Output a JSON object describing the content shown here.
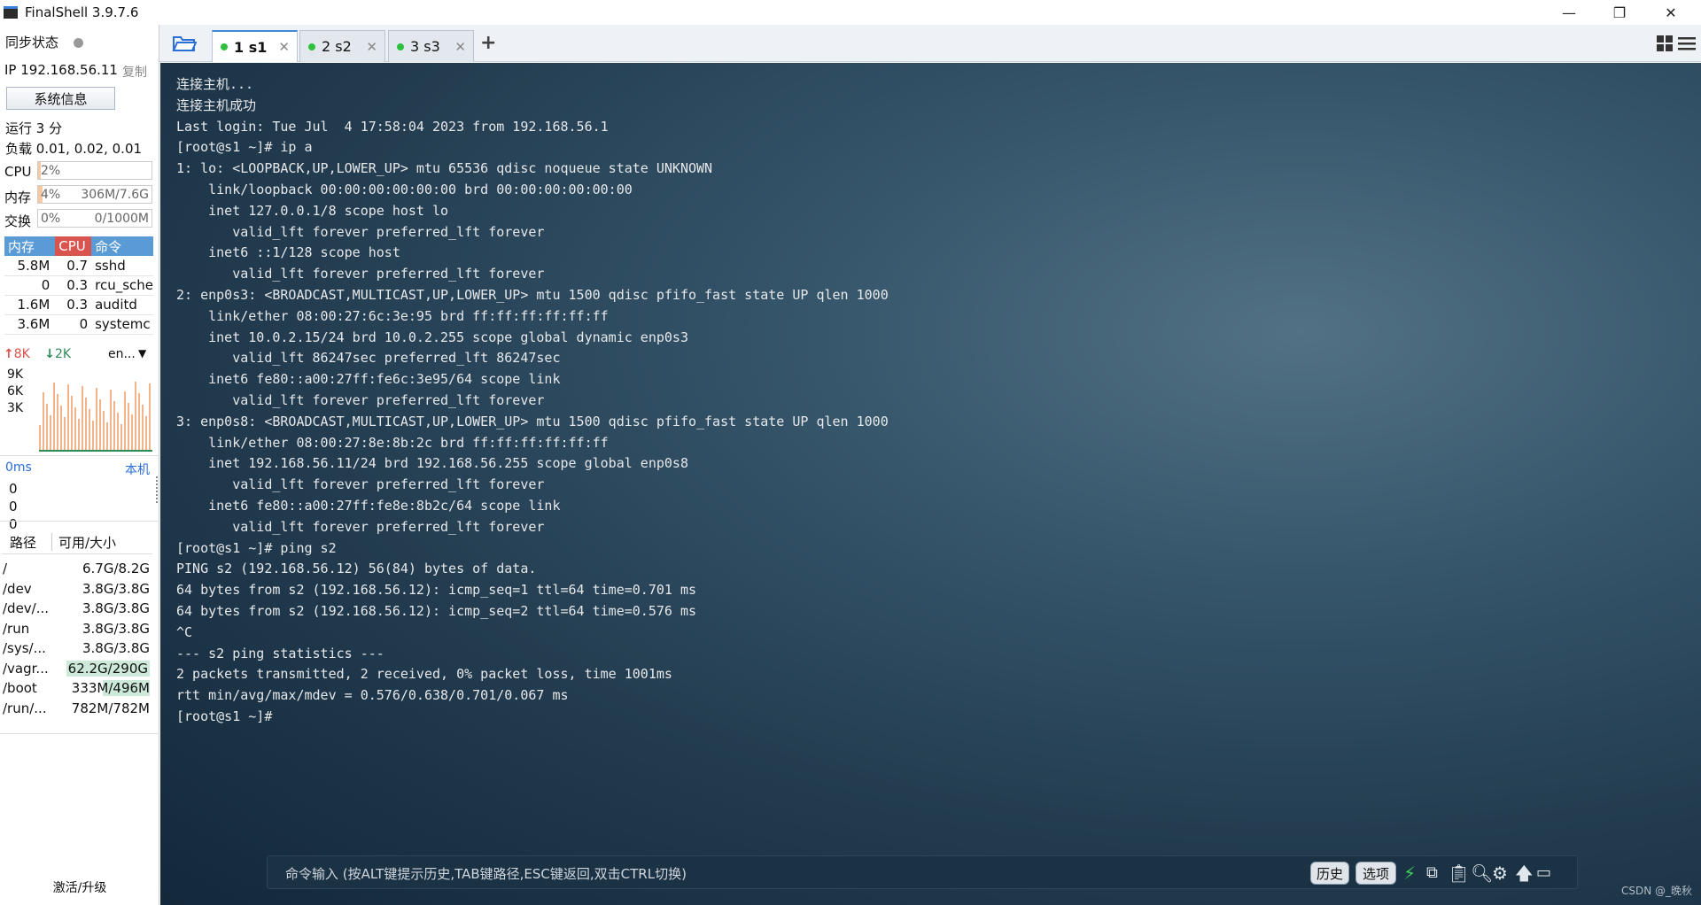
{
  "window": {
    "title": "FinalShell 3.9.7.6",
    "minimize": "—",
    "maximize": "❐",
    "close": "✕"
  },
  "sidebar": {
    "sync_label": "同步状态",
    "ip": "IP 192.168.56.11",
    "copy": "复制",
    "sysinfo_button": "系统信息",
    "uptime": "运行 3 分",
    "load": "负载 0.01, 0.02, 0.01",
    "cpu": {
      "label": "CPU",
      "value": "2%",
      "fraction": 0.02
    },
    "mem": {
      "label": "内存",
      "percent": "4%",
      "value": "306M/7.6G",
      "fraction": 0.04
    },
    "swap": {
      "label": "交换",
      "percent": "0%",
      "value": "0/1000M",
      "fraction": 0.0
    },
    "proc_headers": [
      "内存",
      "CPU",
      "命令"
    ],
    "processes": [
      {
        "mem": "5.8M",
        "cpu": "0.7",
        "cmd": "sshd"
      },
      {
        "mem": "0",
        "cpu": "0.3",
        "cmd": "rcu_sche"
      },
      {
        "mem": "1.6M",
        "cpu": "0.3",
        "cmd": "auditd"
      },
      {
        "mem": "3.6M",
        "cpu": "0",
        "cmd": "systemc"
      }
    ],
    "net": {
      "up": "8K",
      "down": "2K",
      "iface": "en...",
      "ticks": [
        "9K",
        "6K",
        "3K"
      ]
    },
    "ping": {
      "latency": "0ms",
      "host": "本机",
      "values": [
        "0",
        "0",
        "0"
      ]
    },
    "disk_headers": [
      "路径",
      "可用/大小"
    ],
    "disks": [
      {
        "path": "/",
        "size": "6.7G/8.2G"
      },
      {
        "path": "/dev",
        "size": "3.8G/3.8G"
      },
      {
        "path": "/dev/...",
        "size": "3.8G/3.8G"
      },
      {
        "path": "/run",
        "size": "3.8G/3.8G"
      },
      {
        "path": "/sys/...",
        "size": "3.8G/3.8G"
      },
      {
        "path": "/vagr...",
        "size": "62.2G/290G"
      },
      {
        "path": "/boot",
        "size": "333M/496M"
      },
      {
        "path": "/run/...",
        "size": "782M/782M"
      }
    ],
    "activate": "激活/升级"
  },
  "tabs": [
    {
      "label": "1 s1",
      "close": "✕"
    },
    {
      "label": "2 s2",
      "close": "✕"
    },
    {
      "label": "3 s3",
      "close": "✕"
    }
  ],
  "add_tab": "+",
  "terminal": {
    "lines": [
      "连接主机...",
      "连接主机成功",
      "Last login: Tue Jul  4 17:58:04 2023 from 192.168.56.1",
      "[root@s1 ~]# ip a",
      "1: lo: <LOOPBACK,UP,LOWER_UP> mtu 65536 qdisc noqueue state UNKNOWN",
      "    link/loopback 00:00:00:00:00:00 brd 00:00:00:00:00:00",
      "    inet 127.0.0.1/8 scope host lo",
      "       valid_lft forever preferred_lft forever",
      "    inet6 ::1/128 scope host",
      "       valid_lft forever preferred_lft forever",
      "2: enp0s3: <BROADCAST,MULTICAST,UP,LOWER_UP> mtu 1500 qdisc pfifo_fast state UP qlen 1000",
      "    link/ether 08:00:27:6c:3e:95 brd ff:ff:ff:ff:ff:ff",
      "    inet 10.0.2.15/24 brd 10.0.2.255 scope global dynamic enp0s3",
      "       valid_lft 86247sec preferred_lft 86247sec",
      "    inet6 fe80::a00:27ff:fe6c:3e95/64 scope link",
      "       valid_lft forever preferred_lft forever",
      "3: enp0s8: <BROADCAST,MULTICAST,UP,LOWER_UP> mtu 1500 qdisc pfifo_fast state UP qlen 1000",
      "    link/ether 08:00:27:8e:8b:2c brd ff:ff:ff:ff:ff:ff",
      "    inet 192.168.56.11/24 brd 192.168.56.255 scope global enp0s8",
      "       valid_lft forever preferred_lft forever",
      "    inet6 fe80::a00:27ff:fe8e:8b2c/64 scope link",
      "       valid_lft forever preferred_lft forever",
      "[root@s1 ~]# ping s2",
      "PING s2 (192.168.56.12) 56(84) bytes of data.",
      "64 bytes from s2 (192.168.56.12): icmp_seq=1 ttl=64 time=0.701 ms",
      "64 bytes from s2 (192.168.56.12): icmp_seq=2 ttl=64 time=0.576 ms",
      "^C",
      "--- s2 ping statistics ---",
      "2 packets transmitted, 2 received, 0% packet loss, time 1001ms",
      "rtt min/avg/max/mdev = 0.576/0.638/0.701/0.067 ms",
      "[root@s1 ~]# "
    ]
  },
  "command_bar": {
    "placeholder": "命令输入 (按ALT键提示历史,TAB键路径,ESC键返回,双击CTRL切换)",
    "history": "历史",
    "options": "选项"
  },
  "watermark": "CSDN @_晚秋",
  "colors": {
    "accent": "#3d8bd9",
    "online_dot": "#2fbf3f",
    "cpu_header": "#d9534f",
    "mem_header": "#5b9bd5",
    "net_up": "#d9534f",
    "net_down": "#2e8b57"
  }
}
